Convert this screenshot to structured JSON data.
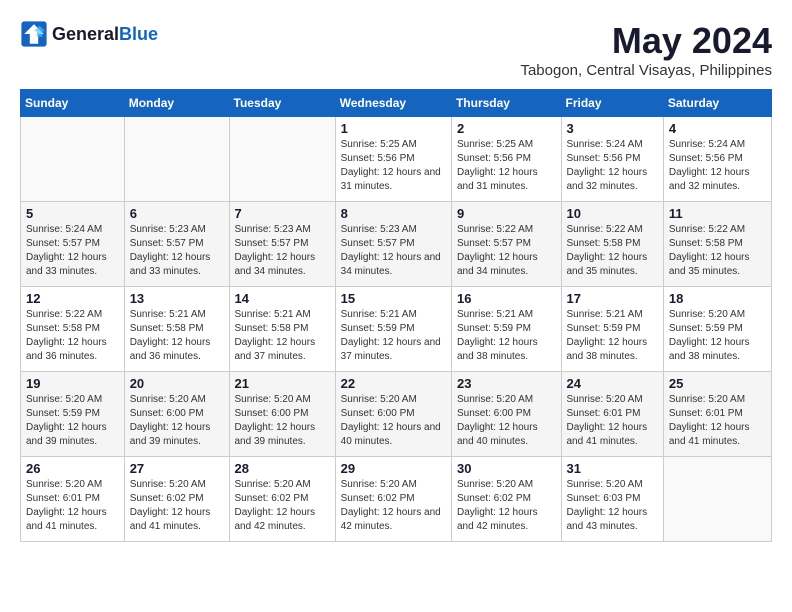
{
  "header": {
    "logo_general": "General",
    "logo_blue": "Blue",
    "month_title": "May 2024",
    "subtitle": "Tabogon, Central Visayas, Philippines"
  },
  "columns": [
    "Sunday",
    "Monday",
    "Tuesday",
    "Wednesday",
    "Thursday",
    "Friday",
    "Saturday"
  ],
  "weeks": [
    {
      "days": [
        {
          "num": "",
          "sunrise": "",
          "sunset": "",
          "daylight": ""
        },
        {
          "num": "",
          "sunrise": "",
          "sunset": "",
          "daylight": ""
        },
        {
          "num": "",
          "sunrise": "",
          "sunset": "",
          "daylight": ""
        },
        {
          "num": "1",
          "sunrise": "Sunrise: 5:25 AM",
          "sunset": "Sunset: 5:56 PM",
          "daylight": "Daylight: 12 hours and 31 minutes."
        },
        {
          "num": "2",
          "sunrise": "Sunrise: 5:25 AM",
          "sunset": "Sunset: 5:56 PM",
          "daylight": "Daylight: 12 hours and 31 minutes."
        },
        {
          "num": "3",
          "sunrise": "Sunrise: 5:24 AM",
          "sunset": "Sunset: 5:56 PM",
          "daylight": "Daylight: 12 hours and 32 minutes."
        },
        {
          "num": "4",
          "sunrise": "Sunrise: 5:24 AM",
          "sunset": "Sunset: 5:56 PM",
          "daylight": "Daylight: 12 hours and 32 minutes."
        }
      ]
    },
    {
      "days": [
        {
          "num": "5",
          "sunrise": "Sunrise: 5:24 AM",
          "sunset": "Sunset: 5:57 PM",
          "daylight": "Daylight: 12 hours and 33 minutes."
        },
        {
          "num": "6",
          "sunrise": "Sunrise: 5:23 AM",
          "sunset": "Sunset: 5:57 PM",
          "daylight": "Daylight: 12 hours and 33 minutes."
        },
        {
          "num": "7",
          "sunrise": "Sunrise: 5:23 AM",
          "sunset": "Sunset: 5:57 PM",
          "daylight": "Daylight: 12 hours and 34 minutes."
        },
        {
          "num": "8",
          "sunrise": "Sunrise: 5:23 AM",
          "sunset": "Sunset: 5:57 PM",
          "daylight": "Daylight: 12 hours and 34 minutes."
        },
        {
          "num": "9",
          "sunrise": "Sunrise: 5:22 AM",
          "sunset": "Sunset: 5:57 PM",
          "daylight": "Daylight: 12 hours and 34 minutes."
        },
        {
          "num": "10",
          "sunrise": "Sunrise: 5:22 AM",
          "sunset": "Sunset: 5:58 PM",
          "daylight": "Daylight: 12 hours and 35 minutes."
        },
        {
          "num": "11",
          "sunrise": "Sunrise: 5:22 AM",
          "sunset": "Sunset: 5:58 PM",
          "daylight": "Daylight: 12 hours and 35 minutes."
        }
      ]
    },
    {
      "days": [
        {
          "num": "12",
          "sunrise": "Sunrise: 5:22 AM",
          "sunset": "Sunset: 5:58 PM",
          "daylight": "Daylight: 12 hours and 36 minutes."
        },
        {
          "num": "13",
          "sunrise": "Sunrise: 5:21 AM",
          "sunset": "Sunset: 5:58 PM",
          "daylight": "Daylight: 12 hours and 36 minutes."
        },
        {
          "num": "14",
          "sunrise": "Sunrise: 5:21 AM",
          "sunset": "Sunset: 5:58 PM",
          "daylight": "Daylight: 12 hours and 37 minutes."
        },
        {
          "num": "15",
          "sunrise": "Sunrise: 5:21 AM",
          "sunset": "Sunset: 5:59 PM",
          "daylight": "Daylight: 12 hours and 37 minutes."
        },
        {
          "num": "16",
          "sunrise": "Sunrise: 5:21 AM",
          "sunset": "Sunset: 5:59 PM",
          "daylight": "Daylight: 12 hours and 38 minutes."
        },
        {
          "num": "17",
          "sunrise": "Sunrise: 5:21 AM",
          "sunset": "Sunset: 5:59 PM",
          "daylight": "Daylight: 12 hours and 38 minutes."
        },
        {
          "num": "18",
          "sunrise": "Sunrise: 5:20 AM",
          "sunset": "Sunset: 5:59 PM",
          "daylight": "Daylight: 12 hours and 38 minutes."
        }
      ]
    },
    {
      "days": [
        {
          "num": "19",
          "sunrise": "Sunrise: 5:20 AM",
          "sunset": "Sunset: 5:59 PM",
          "daylight": "Daylight: 12 hours and 39 minutes."
        },
        {
          "num": "20",
          "sunrise": "Sunrise: 5:20 AM",
          "sunset": "Sunset: 6:00 PM",
          "daylight": "Daylight: 12 hours and 39 minutes."
        },
        {
          "num": "21",
          "sunrise": "Sunrise: 5:20 AM",
          "sunset": "Sunset: 6:00 PM",
          "daylight": "Daylight: 12 hours and 39 minutes."
        },
        {
          "num": "22",
          "sunrise": "Sunrise: 5:20 AM",
          "sunset": "Sunset: 6:00 PM",
          "daylight": "Daylight: 12 hours and 40 minutes."
        },
        {
          "num": "23",
          "sunrise": "Sunrise: 5:20 AM",
          "sunset": "Sunset: 6:00 PM",
          "daylight": "Daylight: 12 hours and 40 minutes."
        },
        {
          "num": "24",
          "sunrise": "Sunrise: 5:20 AM",
          "sunset": "Sunset: 6:01 PM",
          "daylight": "Daylight: 12 hours and 41 minutes."
        },
        {
          "num": "25",
          "sunrise": "Sunrise: 5:20 AM",
          "sunset": "Sunset: 6:01 PM",
          "daylight": "Daylight: 12 hours and 41 minutes."
        }
      ]
    },
    {
      "days": [
        {
          "num": "26",
          "sunrise": "Sunrise: 5:20 AM",
          "sunset": "Sunset: 6:01 PM",
          "daylight": "Daylight: 12 hours and 41 minutes."
        },
        {
          "num": "27",
          "sunrise": "Sunrise: 5:20 AM",
          "sunset": "Sunset: 6:02 PM",
          "daylight": "Daylight: 12 hours and 41 minutes."
        },
        {
          "num": "28",
          "sunrise": "Sunrise: 5:20 AM",
          "sunset": "Sunset: 6:02 PM",
          "daylight": "Daylight: 12 hours and 42 minutes."
        },
        {
          "num": "29",
          "sunrise": "Sunrise: 5:20 AM",
          "sunset": "Sunset: 6:02 PM",
          "daylight": "Daylight: 12 hours and 42 minutes."
        },
        {
          "num": "30",
          "sunrise": "Sunrise: 5:20 AM",
          "sunset": "Sunset: 6:02 PM",
          "daylight": "Daylight: 12 hours and 42 minutes."
        },
        {
          "num": "31",
          "sunrise": "Sunrise: 5:20 AM",
          "sunset": "Sunset: 6:03 PM",
          "daylight": "Daylight: 12 hours and 43 minutes."
        },
        {
          "num": "",
          "sunrise": "",
          "sunset": "",
          "daylight": ""
        }
      ]
    }
  ]
}
